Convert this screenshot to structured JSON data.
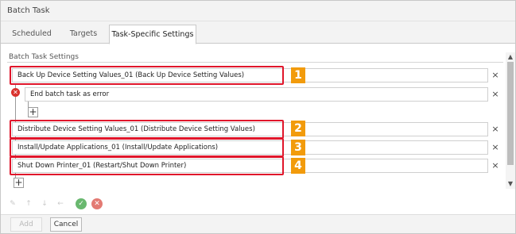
{
  "window": {
    "title": "Batch Task"
  },
  "tabs": [
    {
      "label": "Scheduled"
    },
    {
      "label": "Targets"
    },
    {
      "label": "Task-Specific Settings",
      "selected": true
    }
  ],
  "section": {
    "label": "Batch Task Settings"
  },
  "tasks": [
    {
      "label": "Back Up Device Setting Values_01 (Back Up Device Setting Values)",
      "callout": "1"
    },
    {
      "label": "End batch task as error",
      "sub": true
    },
    {
      "label": "Distribute Device Setting Values_01 (Distribute Device Setting Values)",
      "callout": "2"
    },
    {
      "label": "Install/Update Applications_01 (Install/Update Applications)",
      "callout": "3"
    },
    {
      "label": "Shut Down Printer_01 (Restart/Shut Down Printer)",
      "callout": "4"
    }
  ],
  "icons": {
    "delete": "×",
    "add": "+",
    "error": "✕",
    "scroll_up": "▲",
    "scroll_down": "▼"
  },
  "toolbar": {
    "edit_icon": "✎",
    "up_icon": "↑",
    "down_icon": "↓",
    "left_icon": "←",
    "ok_icon": "✓",
    "cancel_icon": "✕"
  },
  "footer": {
    "add_label": "Add",
    "cancel_label": "Cancel"
  },
  "colors": {
    "highlight": "#e0162b",
    "callout": "#f29b0c",
    "error": "#d9312c"
  }
}
